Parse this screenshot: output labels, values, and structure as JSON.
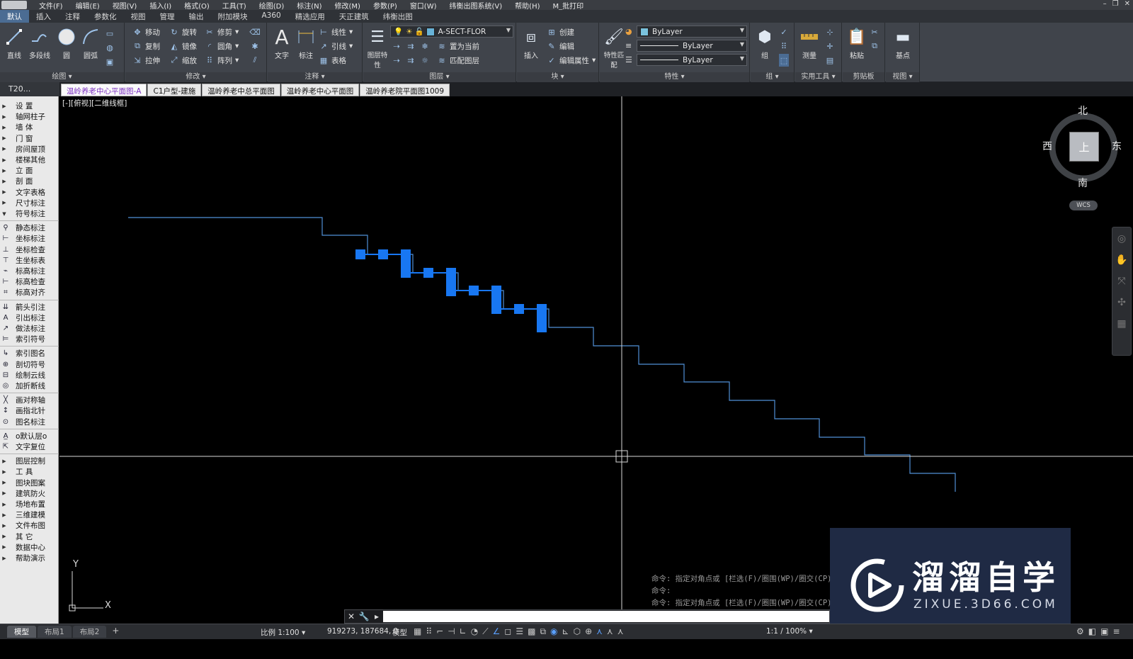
{
  "menu": [
    "文件(F)",
    "编辑(E)",
    "视图(V)",
    "插入(I)",
    "格式(O)",
    "工具(T)",
    "绘图(D)",
    "标注(N)",
    "修改(M)",
    "参数(P)",
    "窗口(W)",
    "纬衡出图系统(V)",
    "帮助(H)",
    "M_批打印"
  ],
  "ribbon_tabs": [
    "默认",
    "插入",
    "注释",
    "参数化",
    "视图",
    "管理",
    "输出",
    "附加模块",
    "A360",
    "精选应用",
    "天正建筑",
    "纬衡出图"
  ],
  "ribbon": {
    "draw": {
      "title": "绘图",
      "line": "直线",
      "polyline": "多段线",
      "circle": "圆",
      "arc": "圆弧"
    },
    "modify": {
      "title": "修改",
      "move": "移动",
      "rotate": "旋转",
      "trim": "修剪",
      "copy": "复制",
      "mirror": "镜像",
      "fillet": "圆角",
      "stretch": "拉伸",
      "scale": "缩放",
      "array": "阵列"
    },
    "annotation": {
      "title": "注释",
      "text": "文字",
      "dimension": "标注",
      "linear": "线性",
      "leader": "引线",
      "table": "表格"
    },
    "layers": {
      "title": "图层",
      "props": "图层特性",
      "current_layer": "A-SECT-FLOR",
      "set_current": "置为当前",
      "match_layer": "匹配图层"
    },
    "block": {
      "title": "块",
      "insert": "插入",
      "create": "创建",
      "edit": "编辑",
      "edit_attr": "编辑属性"
    },
    "properties": {
      "title": "特性",
      "match": "特性匹配",
      "color": "ByLayer",
      "linetype": "ByLayer",
      "lineweight": "ByLayer"
    },
    "groups": {
      "title": "组",
      "group": "组"
    },
    "utilities": {
      "title": "实用工具",
      "measure": "测量"
    },
    "clipboard": {
      "title": "剪贴板",
      "paste": "粘贴"
    },
    "view": {
      "title": "视图",
      "base": "基点"
    }
  },
  "file_tabs": {
    "palette_title": "T20...",
    "tabs": [
      "温岭养老中心平面图-A",
      "C1户型-建施",
      "温岭养老中总平面图",
      "温岭养老中心平面图",
      "温岭养老院平面图1009"
    ],
    "active_index": 0
  },
  "left_palette": [
    {
      "label": "设    置",
      "kind": "grp"
    },
    {
      "label": "轴网柱子",
      "kind": "grp"
    },
    {
      "label": "墙    体",
      "kind": "grp"
    },
    {
      "label": "门    窗",
      "kind": "grp"
    },
    {
      "label": "房间屋顶",
      "kind": "grp"
    },
    {
      "label": "楼梯其他",
      "kind": "grp"
    },
    {
      "label": "立    面",
      "kind": "grp"
    },
    {
      "label": "剖    面",
      "kind": "grp"
    },
    {
      "label": "文字表格",
      "kind": "grp"
    },
    {
      "label": "尺寸标注",
      "kind": "grp"
    },
    {
      "label": "符号标注",
      "kind": "open"
    },
    {
      "label": "静态标注",
      "kind": "cmd"
    },
    {
      "label": "坐标标注",
      "kind": "cmd"
    },
    {
      "label": "坐标检查",
      "kind": "cmd"
    },
    {
      "label": "生坐标表",
      "kind": "cmd"
    },
    {
      "label": "标高标注",
      "kind": "cmd"
    },
    {
      "label": "标高检查",
      "kind": "cmd"
    },
    {
      "label": "标高对齐",
      "kind": "cmd"
    },
    {
      "label": "箭头引注",
      "kind": "cmd"
    },
    {
      "label": "引出标注",
      "kind": "cmd"
    },
    {
      "label": "做法标注",
      "kind": "cmd"
    },
    {
      "label": "索引符号",
      "kind": "cmd"
    },
    {
      "label": "索引图名",
      "kind": "cmd"
    },
    {
      "label": "剖切符号",
      "kind": "cmd"
    },
    {
      "label": "绘制云线",
      "kind": "cmd"
    },
    {
      "label": "加折断线",
      "kind": "cmd"
    },
    {
      "label": "画对称轴",
      "kind": "cmd"
    },
    {
      "label": "画指北针",
      "kind": "cmd"
    },
    {
      "label": "图名标注",
      "kind": "cmd"
    },
    {
      "label": "o默认层o",
      "kind": "cmd"
    },
    {
      "label": "文字复位",
      "kind": "cmd"
    },
    {
      "label": "图层控制",
      "kind": "grp"
    },
    {
      "label": "工    具",
      "kind": "grp"
    },
    {
      "label": "图块图案",
      "kind": "grp"
    },
    {
      "label": "建筑防火",
      "kind": "grp"
    },
    {
      "label": "场地布置",
      "kind": "grp"
    },
    {
      "label": "三维建模",
      "kind": "grp"
    },
    {
      "label": "文件布图",
      "kind": "grp"
    },
    {
      "label": "其    它",
      "kind": "grp"
    },
    {
      "label": "数据中心",
      "kind": "grp"
    },
    {
      "label": "帮助演示",
      "kind": "grp"
    }
  ],
  "canvas": {
    "view_label": "[-][俯视][二维线框]",
    "ucs_x": "X",
    "ucs_y": "Y",
    "colors": {
      "line": "#4f8fd6",
      "selected": "#1877f2",
      "crosshair": "#d8d8d8"
    },
    "command_history": [
      "命令: 指定对角点或 [栏选(F)/圈围(WP)/圈交(CP)]:",
      "命令:",
      "命令: 指定对角点或 [栏选(F)/圈围(WP)/圈交(CP)]:"
    ]
  },
  "viewcube": {
    "north": "北",
    "south": "南",
    "east": "东",
    "west": "西",
    "top": "上",
    "wcs": "WCS"
  },
  "command_input": {
    "value": ""
  },
  "watermark": {
    "title": "溜溜自学",
    "url": "ZIXUE.3D66.COM"
  },
  "status": {
    "layouts": [
      "模型",
      "布局1",
      "布局2"
    ],
    "scale": "比例 1:100",
    "coords": "919273, 187684, 0",
    "model": "模型",
    "annotation_scale": "1:1 / 100%"
  }
}
